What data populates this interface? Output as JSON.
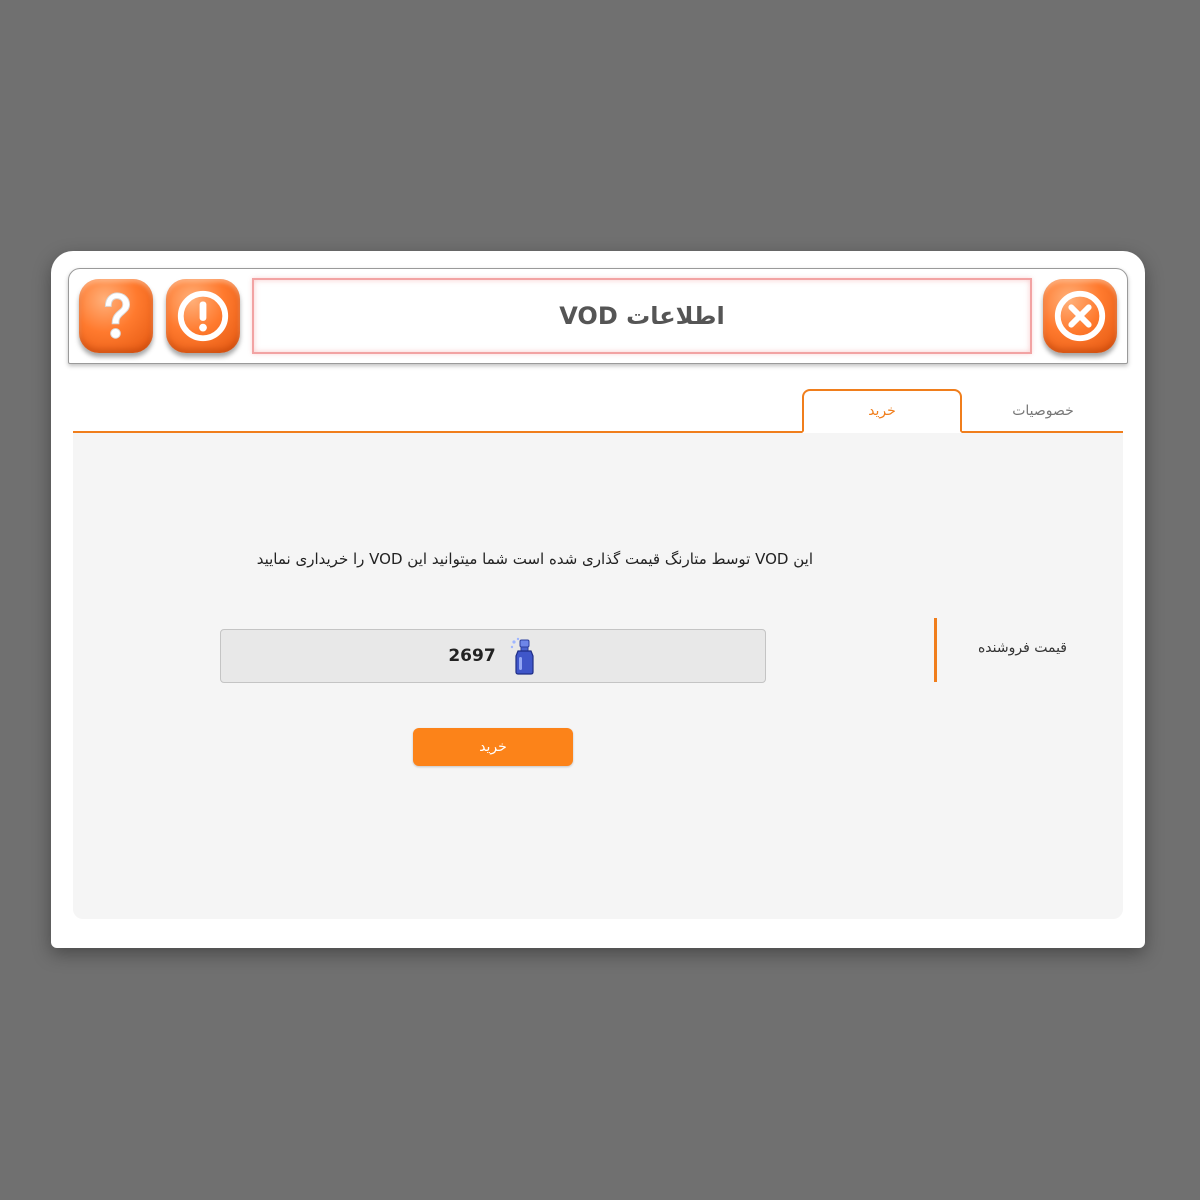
{
  "window": {
    "title": "اطلاعات VOD"
  },
  "header": {
    "help_icon": "help-question-icon",
    "alert_icon": "alert-exclamation-icon",
    "close_icon": "close-x-icon"
  },
  "tabs": [
    {
      "label": "خصوصیات",
      "active": false
    },
    {
      "label": "خرید",
      "active": true
    }
  ],
  "purchase": {
    "message": "این VOD توسط متارنگ قیمت گذاری شده است شما میتوانید این VOD را خریداری نمایید",
    "price_label": "قیمت فروشنده",
    "price_value": "2697",
    "currency_icon": "spray-bottle-icon",
    "buy_label": "خرید"
  },
  "colors": {
    "accent": "#f07e1c",
    "button": "#fc8319",
    "background": "#707070"
  }
}
